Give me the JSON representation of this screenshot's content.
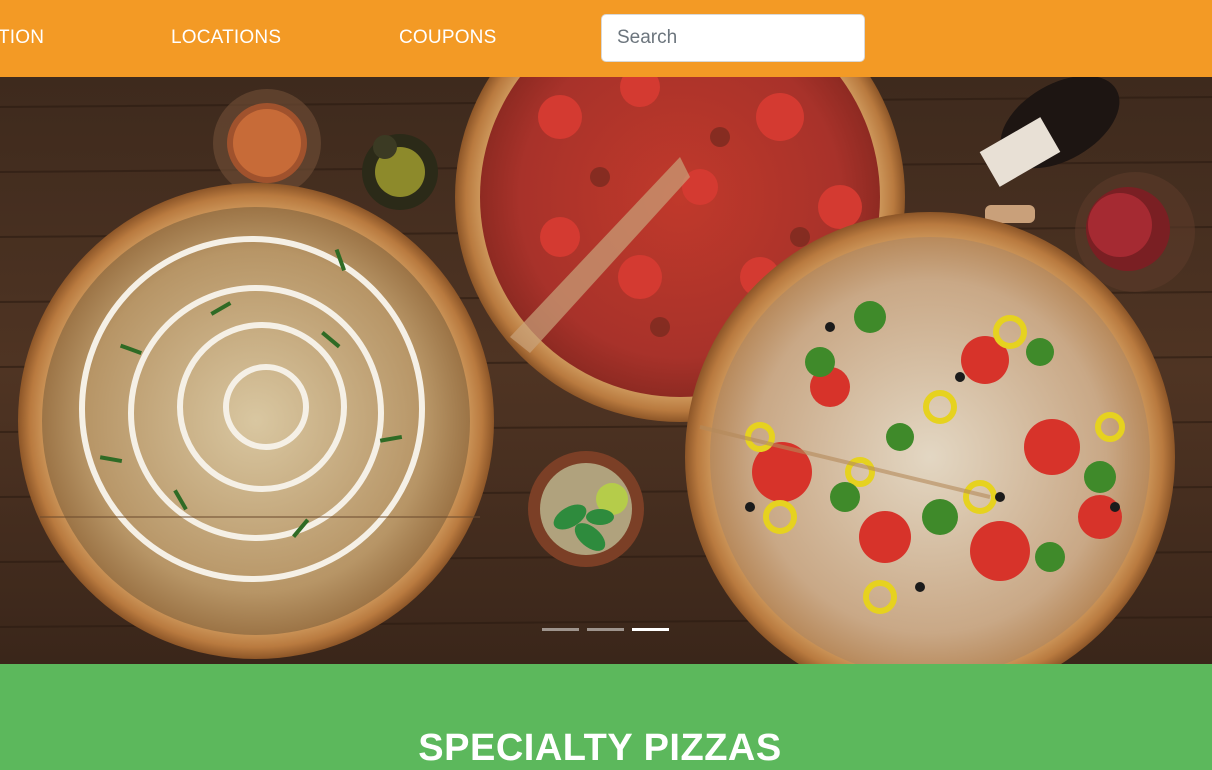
{
  "nav": {
    "links": [
      {
        "label": "TION"
      },
      {
        "label": "LOCATIONS"
      },
      {
        "label": "COUPONS"
      }
    ],
    "search_placeholder": "Search"
  },
  "carousel": {
    "slide_count": 3,
    "active_index": 2
  },
  "section": {
    "title": "SPECIALTY PIZZAS"
  },
  "colors": {
    "nav_bg": "#f39a25",
    "section_bg": "#5cb85c",
    "text": "#ffffff"
  }
}
